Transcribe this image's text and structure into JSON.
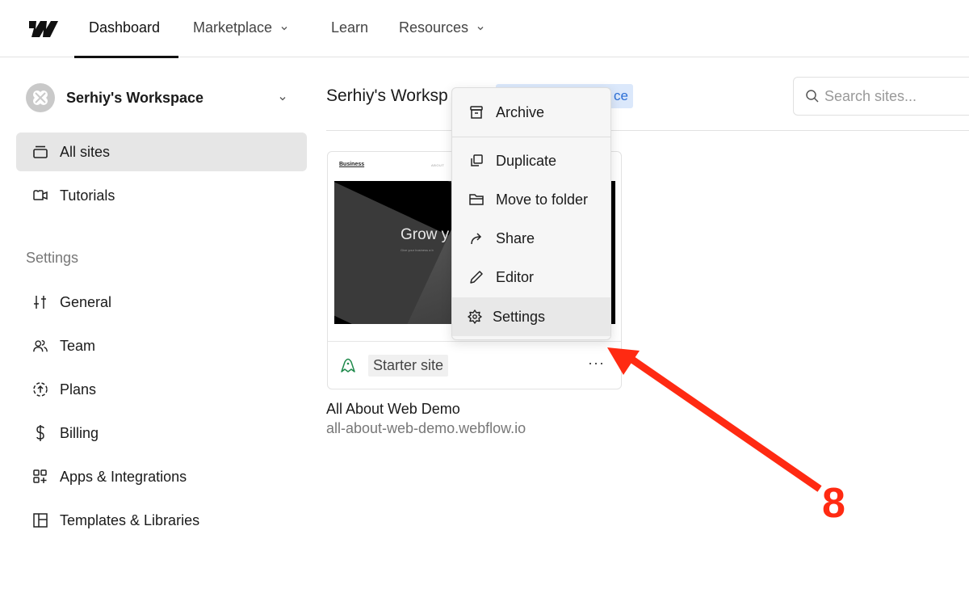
{
  "topnav": {
    "logo": "webflow-logo",
    "items": [
      {
        "label": "Dashboard",
        "active": true,
        "has_dropdown": false
      },
      {
        "label": "Marketplace",
        "active": false,
        "has_dropdown": true
      },
      {
        "label": "Learn",
        "active": false,
        "has_dropdown": false
      },
      {
        "label": "Resources",
        "active": false,
        "has_dropdown": true
      }
    ]
  },
  "sidebar": {
    "workspace_name": "Serhiy's Workspace",
    "nav": [
      {
        "label": "All sites",
        "icon": "sites-stack-icon",
        "active": true
      },
      {
        "label": "Tutorials",
        "icon": "video-camera-icon",
        "active": false
      }
    ],
    "settings_heading": "Settings",
    "settings_items": [
      {
        "label": "General",
        "icon": "sliders-icon"
      },
      {
        "label": "Team",
        "icon": "users-icon"
      },
      {
        "label": "Plans",
        "icon": "upgrade-circle-icon"
      },
      {
        "label": "Billing",
        "icon": "dollar-icon"
      },
      {
        "label": "Apps & Integrations",
        "icon": "apps-add-icon"
      },
      {
        "label": "Templates & Libraries",
        "icon": "layout-template-icon"
      }
    ]
  },
  "main": {
    "title": "Serhiy's Worksp",
    "badge_visible_text": "ce",
    "search": {
      "placeholder": "Search sites...",
      "value": ""
    }
  },
  "site_card": {
    "thumbnail": {
      "brand": "Business",
      "nav_text": "ABOUT",
      "headline": "Grow y",
      "subtext": "Give your business a b"
    },
    "plan_badge": "Starter site",
    "more_label": "···",
    "name": "All About Web Demo",
    "url": "all-about-web-demo.webflow.io"
  },
  "context_menu": {
    "items": [
      {
        "label": "Archive",
        "icon": "archive-icon"
      },
      {
        "label": "Duplicate",
        "icon": "duplicate-icon"
      },
      {
        "label": "Move to folder",
        "icon": "folder-icon"
      },
      {
        "label": "Share",
        "icon": "share-arrow-icon"
      },
      {
        "label": "Editor",
        "icon": "pencil-icon"
      },
      {
        "label": "Settings",
        "icon": "gear-icon",
        "highlighted": true
      }
    ]
  },
  "annotation": {
    "step_number": "8",
    "color": "#ff2a12"
  },
  "colors": {
    "accent_blue": "#2d6fd6",
    "badge_bg": "#dbe8fb",
    "starter_green": "#1f8a4c"
  }
}
